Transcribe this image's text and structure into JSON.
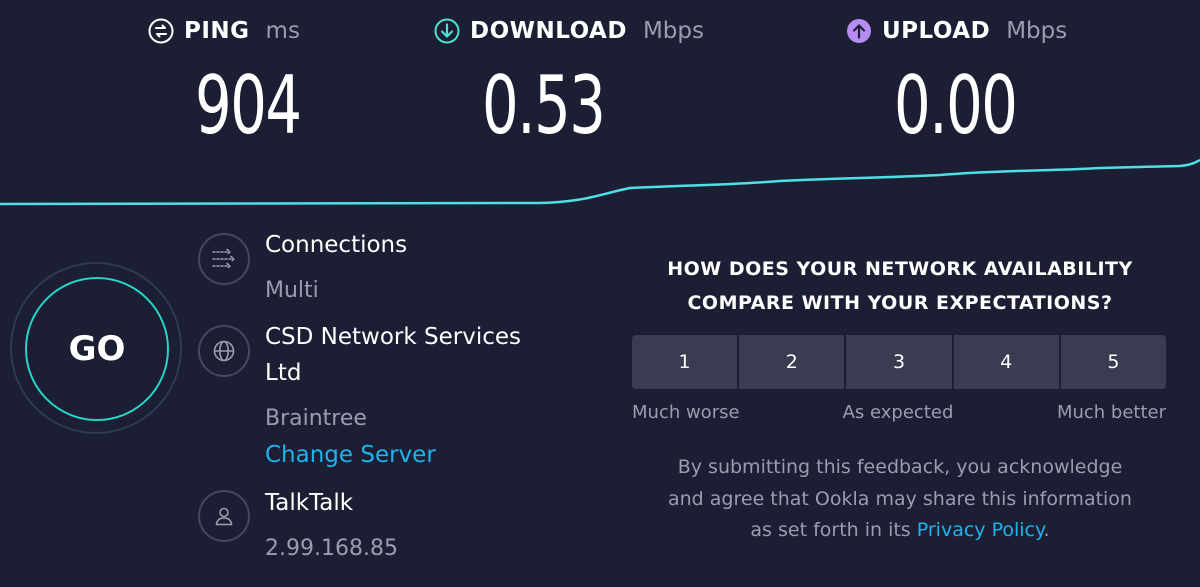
{
  "metrics": {
    "ping": {
      "label": "PING",
      "unit": "ms",
      "value": "904",
      "icon": "ping-icon"
    },
    "download": {
      "label": "DOWNLOAD",
      "unit": "Mbps",
      "value": "0.53",
      "icon": "download-arrow-icon",
      "color": "#4fe0d2"
    },
    "upload": {
      "label": "UPLOAD",
      "unit": "Mbps",
      "value": "0.00",
      "icon": "upload-arrow-icon",
      "color": "#b58cf0"
    }
  },
  "go_button": {
    "label": "GO",
    "ring_color": "#27d4c8"
  },
  "connections": {
    "title": "Connections",
    "value": "Multi",
    "icon": "connections-icon"
  },
  "server": {
    "name_line1": "CSD Network Services",
    "name_line2": "Ltd",
    "location": "Braintree",
    "change_label": "Change Server",
    "icon": "globe-icon"
  },
  "provider": {
    "name": "TalkTalk",
    "ip": "2.99.168.85",
    "icon": "user-icon"
  },
  "survey": {
    "question_line1": "HOW DOES YOUR NETWORK AVAILABILITY",
    "question_line2": "COMPARE WITH YOUR EXPECTATIONS?",
    "ratings": [
      "1",
      "2",
      "3",
      "4",
      "5"
    ],
    "scale_low": "Much worse",
    "scale_mid": "As expected",
    "scale_high": "Much better",
    "disclaimer_line1": "By submitting this feedback, you acknowledge",
    "disclaimer_line2": "and agree that Ookla may share this information",
    "disclaimer_line3_pre": "as set forth in its ",
    "privacy_link": "Privacy Policy",
    "disclaimer_line3_post": "."
  },
  "colors": {
    "background": "#1c1e33",
    "accent_link": "#1fb3ee",
    "graph_line": "#4fe0e6"
  }
}
